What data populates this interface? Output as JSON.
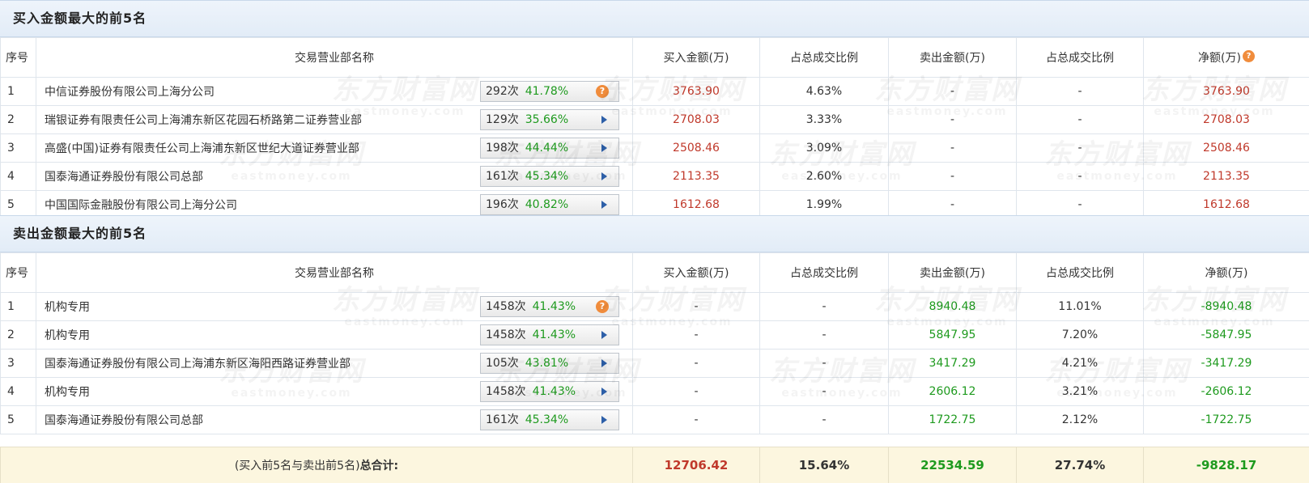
{
  "buy_section": {
    "title": "买入金额最大的前5名",
    "headers": {
      "seq": "序号",
      "name": "交易营业部名称",
      "buy": "买入金额(万)",
      "buy_ratio": "占总成交比例",
      "sell": "卖出金额(万)",
      "sell_ratio": "占总成交比例",
      "net": "净额(万)"
    },
    "rows": [
      {
        "seq": "1",
        "name": "中信证券股份有限公司上海分公司",
        "count": "292次",
        "win": "41.78%",
        "icon": "help-icon",
        "buy": "3763.90",
        "buy_ratio": "4.63%",
        "sell": "-",
        "sell_ratio": "-",
        "net": "3763.90"
      },
      {
        "seq": "2",
        "name": "瑞银证券有限责任公司上海浦东新区花园石桥路第二证券营业部",
        "count": "129次",
        "win": "35.66%",
        "icon": "arrow-right-icon",
        "buy": "2708.03",
        "buy_ratio": "3.33%",
        "sell": "-",
        "sell_ratio": "-",
        "net": "2708.03"
      },
      {
        "seq": "3",
        "name": "高盛(中国)证券有限责任公司上海浦东新区世纪大道证券营业部",
        "count": "198次",
        "win": "44.44%",
        "icon": "arrow-right-icon",
        "buy": "2508.46",
        "buy_ratio": "3.09%",
        "sell": "-",
        "sell_ratio": "-",
        "net": "2508.46"
      },
      {
        "seq": "4",
        "name": "国泰海通证券股份有限公司总部",
        "count": "161次",
        "win": "45.34%",
        "icon": "arrow-right-icon",
        "buy": "2113.35",
        "buy_ratio": "2.60%",
        "sell": "-",
        "sell_ratio": "-",
        "net": "2113.35"
      },
      {
        "seq": "5",
        "name": "中国国际金融股份有限公司上海分公司",
        "count": "196次",
        "win": "40.82%",
        "icon": "arrow-right-icon",
        "buy": "1612.68",
        "buy_ratio": "1.99%",
        "sell": "-",
        "sell_ratio": "-",
        "net": "1612.68"
      }
    ]
  },
  "sell_section": {
    "title": "卖出金额最大的前5名",
    "headers": {
      "seq": "序号",
      "name": "交易营业部名称",
      "buy": "买入金额(万)",
      "buy_ratio": "占总成交比例",
      "sell": "卖出金额(万)",
      "sell_ratio": "占总成交比例",
      "net": "净额(万)"
    },
    "rows": [
      {
        "seq": "1",
        "name": "机构专用",
        "count": "1458次",
        "win": "41.43%",
        "icon": "help-icon",
        "buy": "-",
        "buy_ratio": "-",
        "sell": "8940.48",
        "sell_ratio": "11.01%",
        "net": "-8940.48"
      },
      {
        "seq": "2",
        "name": "机构专用",
        "count": "1458次",
        "win": "41.43%",
        "icon": "arrow-right-icon",
        "buy": "-",
        "buy_ratio": "-",
        "sell": "5847.95",
        "sell_ratio": "7.20%",
        "net": "-5847.95"
      },
      {
        "seq": "3",
        "name": "国泰海通证券股份有限公司上海浦东新区海阳西路证券营业部",
        "count": "105次",
        "win": "43.81%",
        "icon": "arrow-right-icon",
        "buy": "-",
        "buy_ratio": "-",
        "sell": "3417.29",
        "sell_ratio": "4.21%",
        "net": "-3417.29"
      },
      {
        "seq": "4",
        "name": "机构专用",
        "count": "1458次",
        "win": "41.43%",
        "icon": "arrow-right-icon",
        "buy": "-",
        "buy_ratio": "-",
        "sell": "2606.12",
        "sell_ratio": "3.21%",
        "net": "-2606.12"
      },
      {
        "seq": "5",
        "name": "国泰海通证券股份有限公司总部",
        "count": "161次",
        "win": "45.34%",
        "icon": "arrow-right-icon",
        "buy": "-",
        "buy_ratio": "-",
        "sell": "1722.75",
        "sell_ratio": "2.12%",
        "net": "-1722.75"
      }
    ]
  },
  "total": {
    "label_prefix": "(买入前5名与卖出前5名)",
    "label_bold": "总合计:",
    "buy": "12706.42",
    "buy_ratio": "15.64%",
    "sell": "22534.59",
    "sell_ratio": "27.74%",
    "net": "-9828.17"
  },
  "watermark": {
    "cn": "东方财富网",
    "en": "eastmoney.com"
  },
  "colors": {
    "buy": "#c0392b",
    "sell": "#1e9a1e",
    "accent": "#f08c3c",
    "arrow": "#2d5fa8",
    "total_bg": "#fcf6df"
  }
}
